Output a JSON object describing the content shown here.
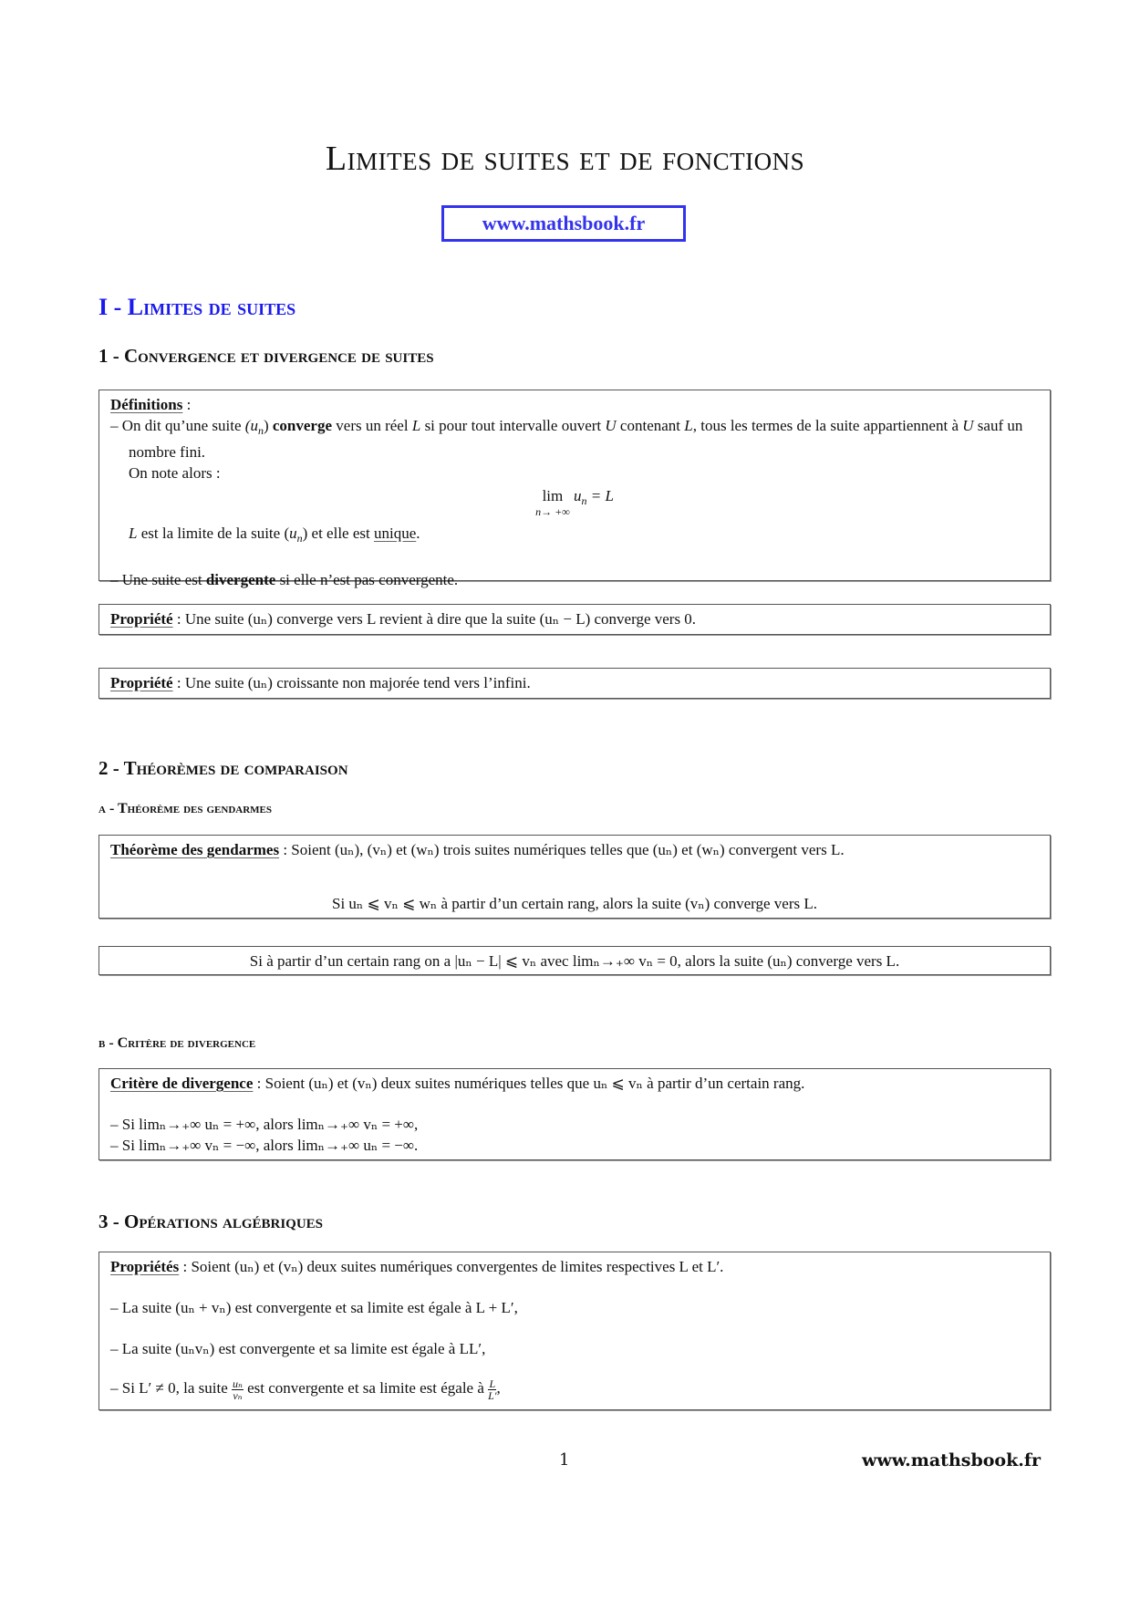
{
  "document": {
    "title": "Limites de suites et de fonctions",
    "site_link": "www.mathsbook.fr",
    "accent_color": "#1a1aee"
  },
  "section1": {
    "heading": "I - Limites de suites",
    "sub1": {
      "heading": "1 - Convergence et divergence de suites",
      "definitions_box": {
        "label": "Définitions",
        "colon": " :",
        "item1_pre": "On dit qu’une suite ",
        "item1_seq": "(u",
        "item1_seq_sub": "n",
        "item1_seq_close": ")",
        "item1_bold": "converge",
        "item1_mid": " vers un réel ",
        "item1_L": "L",
        "item1_mid2": " si pour tout intervalle ouvert ",
        "item1_U": "U",
        "item1_mid3": " contenant ",
        "item1_L2": "L",
        "item1_end": ", tous les termes de la suite appartiennent à ",
        "item1_U2": "U",
        "item1_end2": " sauf un nombre fini.",
        "note_line": "On note alors :",
        "formula_lim": "lim",
        "formula_under": "n→ +∞",
        "formula_rhs_u": "u",
        "formula_rhs_sub": "n",
        "formula_rhs_eq": " = L",
        "unique_pre_L": "L",
        "unique_pre": " est la limite de la suite (",
        "unique_u": "u",
        "unique_sub": "n",
        "unique_mid": ") et elle est ",
        "unique_word": "unique",
        "unique_end": ".",
        "item2_pre": "Une suite est ",
        "item2_bold": "divergente",
        "item2_end": " si elle n’est pas convergente."
      },
      "property1": {
        "label": "Propriété",
        "text": " : Une suite (uₙ) converge vers L revient à dire que la suite (uₙ − L) converge vers 0."
      },
      "property2": {
        "label": "Propriété",
        "text": " : Une suite (uₙ) croissante non majorée tend vers l’infini."
      }
    },
    "sub2": {
      "heading": "2 - Théorèmes de comparaison",
      "subA": {
        "heading": "a - Théorème des gendarmes",
        "theorem_box": {
          "label": "Théorème des gendarmes",
          "line1": " : Soient (uₙ), (vₙ) et (wₙ) trois suites numériques telles que (uₙ) et (wₙ) convergent vers L.",
          "line2": "Si uₙ ⩽ vₙ ⩽ wₙ à partir d’un certain rang, alors la suite (vₙ) converge vers L."
        },
        "corollary_box": {
          "text": "Si à partir d’un certain rang on a |uₙ − L| ⩽ vₙ avec limₙ→₊∞ vₙ = 0, alors la suite (uₙ) converge vers L."
        }
      },
      "subB": {
        "heading": "b - Critère de divergence",
        "criterion_box": {
          "label": "Critère de divergence",
          "line1": " : Soient (uₙ) et (vₙ) deux suites numériques telles que uₙ ⩽ vₙ à partir d’un certain rang.",
          "item1": "– Si limₙ→₊∞ uₙ = +∞, alors limₙ→₊∞ vₙ = +∞,",
          "item2": "– Si limₙ→₊∞ vₙ = −∞, alors limₙ→₊∞ uₙ = −∞."
        }
      }
    },
    "sub3": {
      "heading": "3 - Opérations algébriques",
      "properties_box": {
        "label": "Propriétés",
        "line1": " : Soient (uₙ) et (vₙ) deux suites numériques convergentes de limites respectives L et L′.",
        "item1": "– La suite (uₙ + vₙ) est convergente et sa limite est égale à L + L′,",
        "item2": "– La suite (uₙvₙ) est convergente et sa limite est égale à LL′,",
        "item3_pre": "– Si L′ ≠ 0, la suite ",
        "item3_frac_num": "uₙ",
        "item3_frac_den": "vₙ",
        "item3_mid": " est convergente et sa limite est égale à ",
        "item3_frac2_num": "L",
        "item3_frac2_den": "L′",
        "item3_end": ","
      }
    }
  },
  "footer": {
    "page_number": "1",
    "site": "www.mathsbook.fr"
  }
}
